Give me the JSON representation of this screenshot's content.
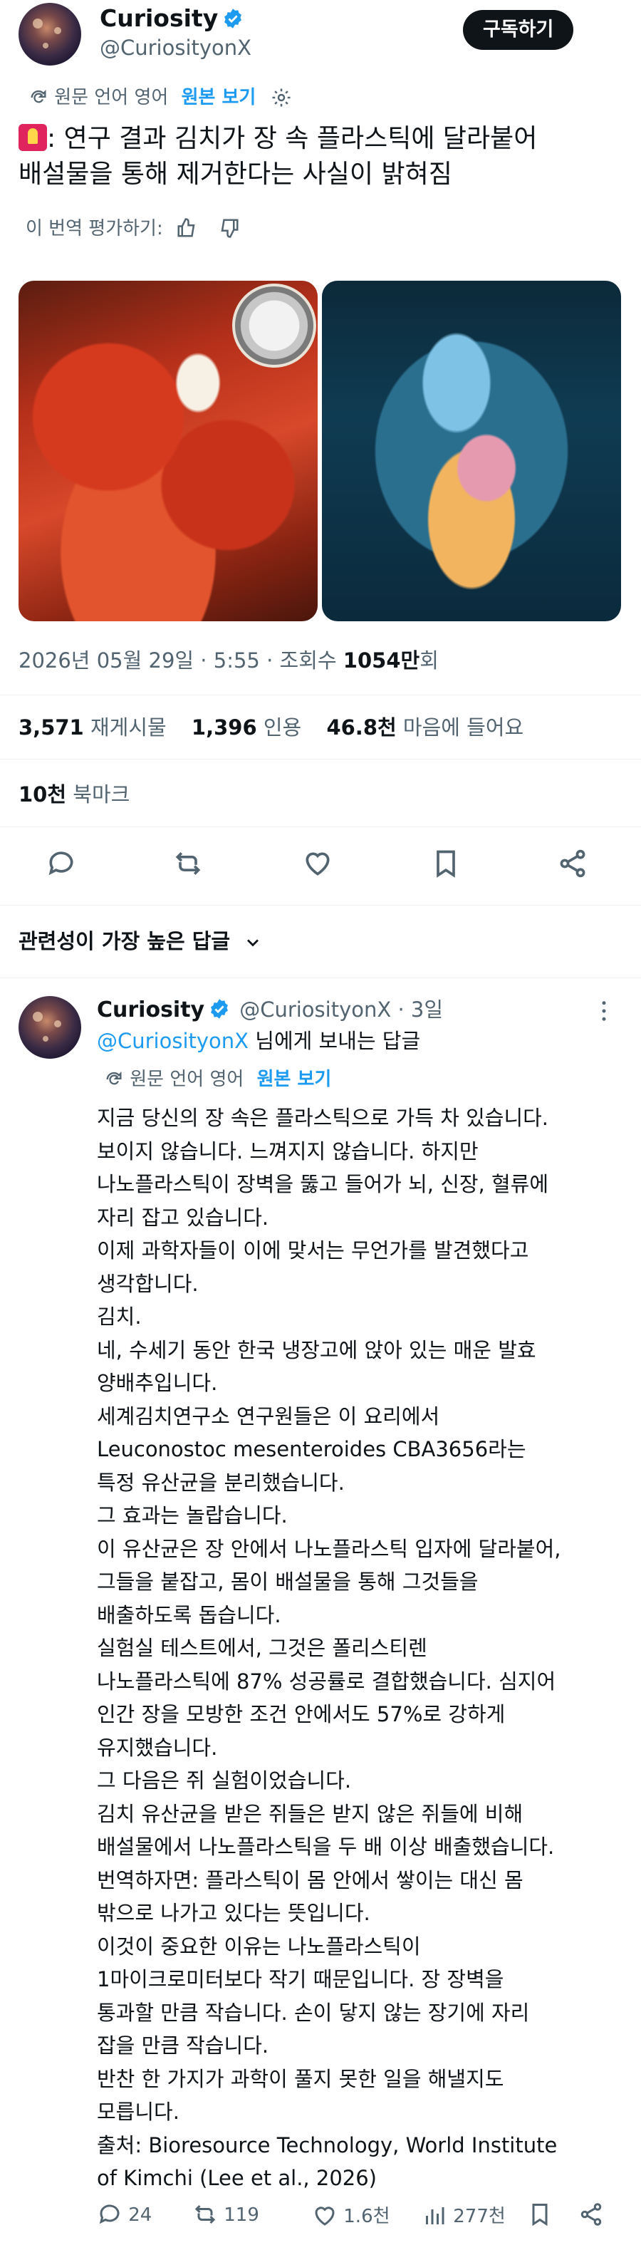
{
  "post": {
    "author_name": "Curiosity",
    "author_handle": "@CuriosityonX",
    "subscribe_label": "구독하기",
    "translate_note": "원문 언어 영어",
    "show_original": "원본 보기",
    "headline": "연구 결과 김치가 장 속 플라스틱에 달라붙어\n배설물을 통해 제거한다는 사실이 밝혀짐",
    "rate_translation": "이 번역 평가하기:",
    "date": "2026년 05월 29일 · 5:55 · 조회수 ",
    "views": "1054만",
    "views_suffix": "회",
    "reposts": "3,571",
    "reposts_label": "재게시물",
    "quotes": "1,396",
    "quotes_label": "인용",
    "likes": "46.8천",
    "likes_label": "마음에 들어요",
    "bookmarks": "10천",
    "bookmarks_label": "북마크"
  },
  "replies_section": {
    "title": "관련성이 가장 높은 답글"
  },
  "reply": {
    "author_name": "Curiosity",
    "author_handle": "@CuriosityonX · 3일",
    "reply_to_handle": "@CuriosityonX",
    "reply_to_suffix": " 님에게 보내는 답글",
    "translate_note": "원문 언어 영어",
    "show_original": "원본 보기",
    "body": "지금 당신의 장 속은 플라스틱으로 가득 차 있습니다.\n보이지 않습니다. 느껴지지 않습니다. 하지만\n나노플라스틱이 장벽을 뚫고 들어가 뇌, 신장, 혈류에\n자리 잡고 있습니다.\n이제 과학자들이 이에 맞서는 무언가를 발견했다고\n생각합니다.\n김치.\n네, 수세기 동안 한국 냉장고에 앉아 있는 매운 발효\n양배추입니다.\n세계김치연구소 연구원들은 이 요리에서\nLeuconostoc mesenteroides CBA3656라는\n특정 유산균을 분리했습니다.\n그 효과는 놀랍습니다.\n이 유산균은 장 안에서 나노플라스틱 입자에 달라붙어,\n그들을 붙잡고, 몸이 배설물을 통해 그것들을\n배출하도록 돕습니다.\n실험실 테스트에서, 그것은 폴리스티렌\n나노플라스틱에 87% 성공률로 결합했습니다. 심지어\n인간 장을 모방한 조건 안에서도 57%로 강하게\n유지했습니다.\n그 다음은 쥐 실험이었습니다.\n김치 유산균을 받은 쥐들은 받지 않은 쥐들에 비해\n배설물에서 나노플라스틱을 두 배 이상 배출했습니다.\n번역하자면: 플라스틱이 몸 안에서 쌓이는 대신 몸\n밖으로 나가고 있다는 뜻입니다.\n이것이 중요한 이유는 나노플라스틱이\n1마이크로미터보다 작기 때문입니다. 장 장벽을\n통과할 만큼 작습니다. 손이 닿지 않는 장기에 자리\n잡을 만큼 작습니다.\n반찬 한 가지가 과학이 풀지 못한 일을 해낼지도\n모릅니다.\n출처: Bioresource Technology, World Institute\nof Kimchi (Lee et al., 2026)",
    "replies": "24",
    "reposts": "119",
    "likes": "1.6천",
    "views": "277천"
  }
}
